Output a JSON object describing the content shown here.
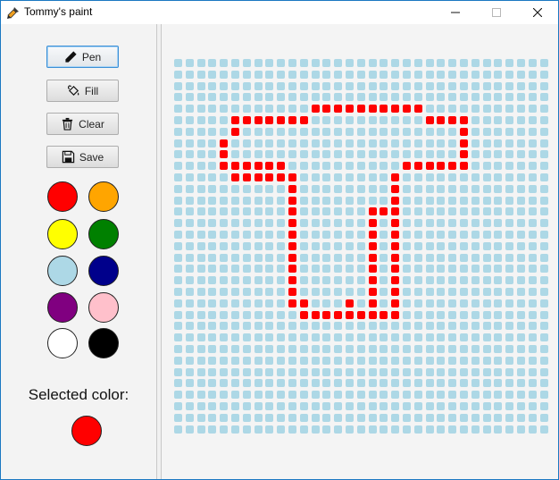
{
  "window": {
    "title": "Tommy's paint"
  },
  "tools": [
    {
      "label": "Pen",
      "icon": "pen-icon",
      "active": true
    },
    {
      "label": "Fill",
      "icon": "fill-bucket-icon",
      "active": false
    },
    {
      "label": "Clear",
      "icon": "trash-icon",
      "active": false
    },
    {
      "label": "Save",
      "icon": "save-icon",
      "active": false
    }
  ],
  "palette": [
    "#ff0000",
    "#ffa500",
    "#ffff00",
    "#008000",
    "#add8e6",
    "#00008b",
    "#800080",
    "#ffc0cb",
    "#ffffff",
    "#000000"
  ],
  "selected": {
    "label": "Selected color:",
    "color": "#ff0000"
  },
  "canvas": {
    "background_color": "#add8e6",
    "paint_color": "#ff0000",
    "columns": 33,
    "rows": 33,
    "painted": [
      "0000000000000000000000000000000000",
      "0000000000000000000000000000000000",
      "0000000000000000000000000000000000",
      "0000000000000000000000000000000000",
      "000000000000111111111100000000000",
      "000001111111000000000011110000000",
      "000001000000000000000000010000000",
      "000010000000000000000000010000000",
      "000010000000000000000000010000000",
      "000011111100000000001111110000000",
      "000001111110000000010000000000000",
      "000000000010000000010000000000000",
      "000000000010000000010000000000000",
      "000000000010000001110000000000000",
      "000000000010000001010000000000000",
      "000000000010000001010000000000000",
      "000000000010000001010000000000000",
      "000000000010000001010000000000000",
      "000000000010000001010000000000000",
      "000000000010000001010000000000000",
      "000000000010000001010000000000000",
      "000000000011000101010000000000000",
      "000000000001111111110000000000000"
    ]
  }
}
